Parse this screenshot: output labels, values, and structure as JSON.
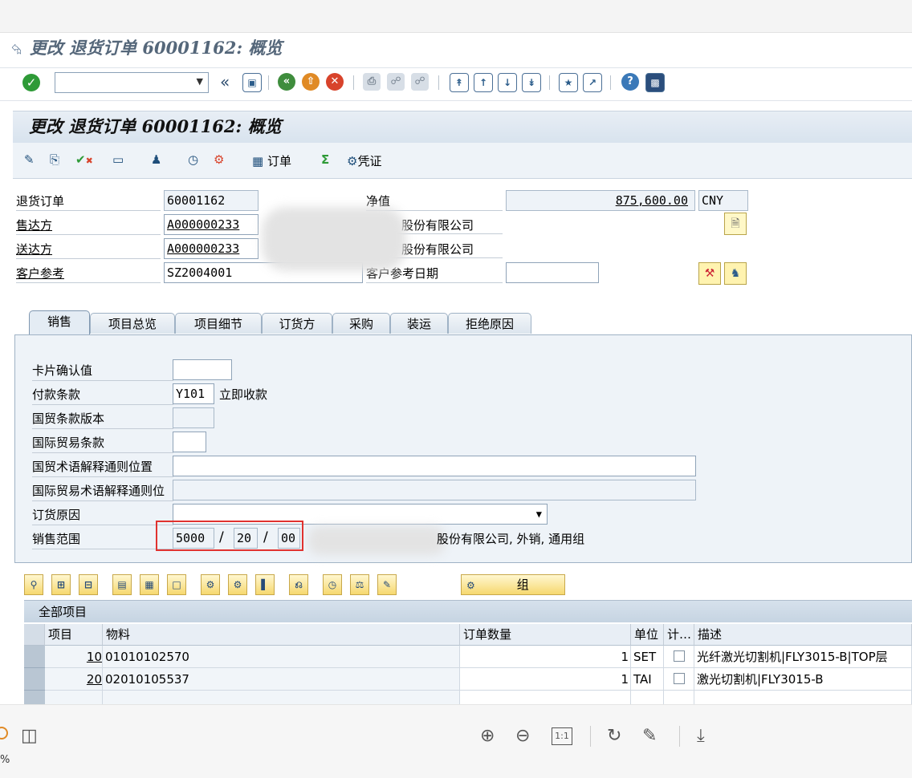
{
  "window": {
    "title": "更改 退货订单 60001162: 概览"
  },
  "app": {
    "title": "更改 退货订单 60001162: 概览"
  },
  "app_toolbar": {
    "order_label": "订单",
    "voucher_label": "凭证"
  },
  "header": {
    "return_order_label": "退货订单",
    "return_order_value": "60001162",
    "net_value_label": "净值",
    "net_value": "875,600.00",
    "currency": "CNY",
    "sold_to_label": "售达方",
    "sold_to_value": "A000000233",
    "sold_to_name": "股份有限公司",
    "ship_to_label": "送达方",
    "ship_to_value": "A000000233",
    "ship_to_name": "股份有限公司",
    "cust_ref_label": "客户参考",
    "cust_ref_value": "SZ2004001",
    "cust_ref_date_label": "客户参考日期"
  },
  "tabs": [
    "销售",
    "项目总览",
    "项目细节",
    "订货方",
    "采购",
    "装运",
    "拒绝原因"
  ],
  "sales_tab": {
    "card_verification_label": "卡片确认值",
    "payment_terms_label": "付款条款",
    "payment_terms_value": "Y101",
    "payment_terms_text": "立即收款",
    "incoterms_version_label": "国贸条款版本",
    "incoterms_label": "国际贸易条款",
    "incoterms_loc_label": "国贸术语解释通则位置",
    "incoterms_loc2_label": "国际贸易术语解释通则位",
    "order_reason_label": "订货原因",
    "sales_area_label": "销售范围",
    "sales_org": "5000",
    "dist_channel": "20",
    "division": "00",
    "sales_area_text": "股份有限公司, 外销, 通用组"
  },
  "grid": {
    "group_button_label": "组",
    "title": "全部项目",
    "columns": [
      "项目",
      "物料",
      "订单数量",
      "单位",
      "计…",
      "描述"
    ],
    "rows": [
      {
        "item": "10",
        "material": "01010102570",
        "qty": "1",
        "unit": "SET",
        "desc": "光纤激光切割机|FLY3015-B|TOP层"
      },
      {
        "item": "20",
        "material": "02010105537",
        "qty": "1",
        "unit": "TAI",
        "desc": "激光切割机|FLY3015-B"
      }
    ]
  },
  "viewer": {
    "zoom_percent": "%"
  }
}
